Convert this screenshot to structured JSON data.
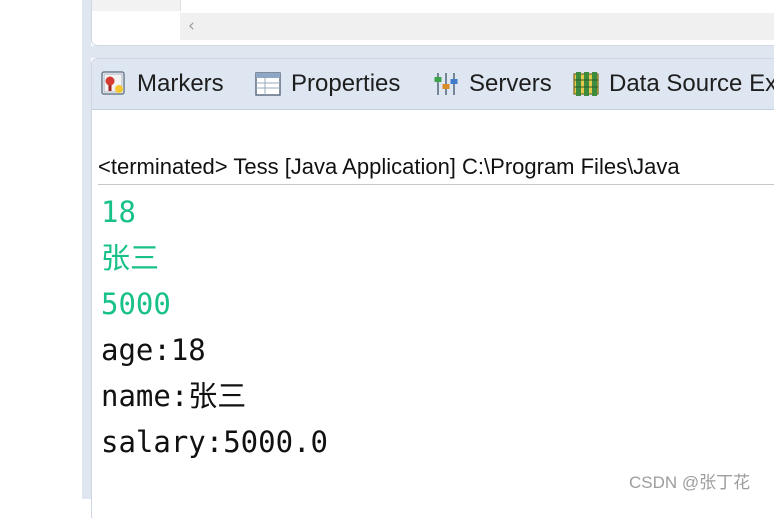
{
  "views": {
    "tabs": [
      {
        "label": "Markers",
        "icon": "markers-icon"
      },
      {
        "label": "Properties",
        "icon": "properties-icon"
      },
      {
        "label": "Servers",
        "icon": "servers-icon"
      },
      {
        "label": "Data Source Ex",
        "icon": "data-source-explorer-icon"
      }
    ]
  },
  "console": {
    "header": "<terminated> Tess [Java Application] C:\\Program Files\\Java",
    "lines": [
      {
        "text": "18",
        "stream": "stderr"
      },
      {
        "text": "张三",
        "stream": "stderr"
      },
      {
        "text": "5000",
        "stream": "stderr"
      },
      {
        "text": "age:18",
        "stream": "stdout"
      },
      {
        "text": "name:张三",
        "stream": "stdout"
      },
      {
        "text": "salary:5000.0",
        "stream": "stdout"
      }
    ],
    "colors": {
      "stderr": "#18c08a",
      "stdout": "#111111"
    }
  },
  "watermark": "CSDN @张丁花",
  "scrollbar": {
    "left_arrow_icon": "chevron-left-icon",
    "left_arrow": "‹"
  }
}
